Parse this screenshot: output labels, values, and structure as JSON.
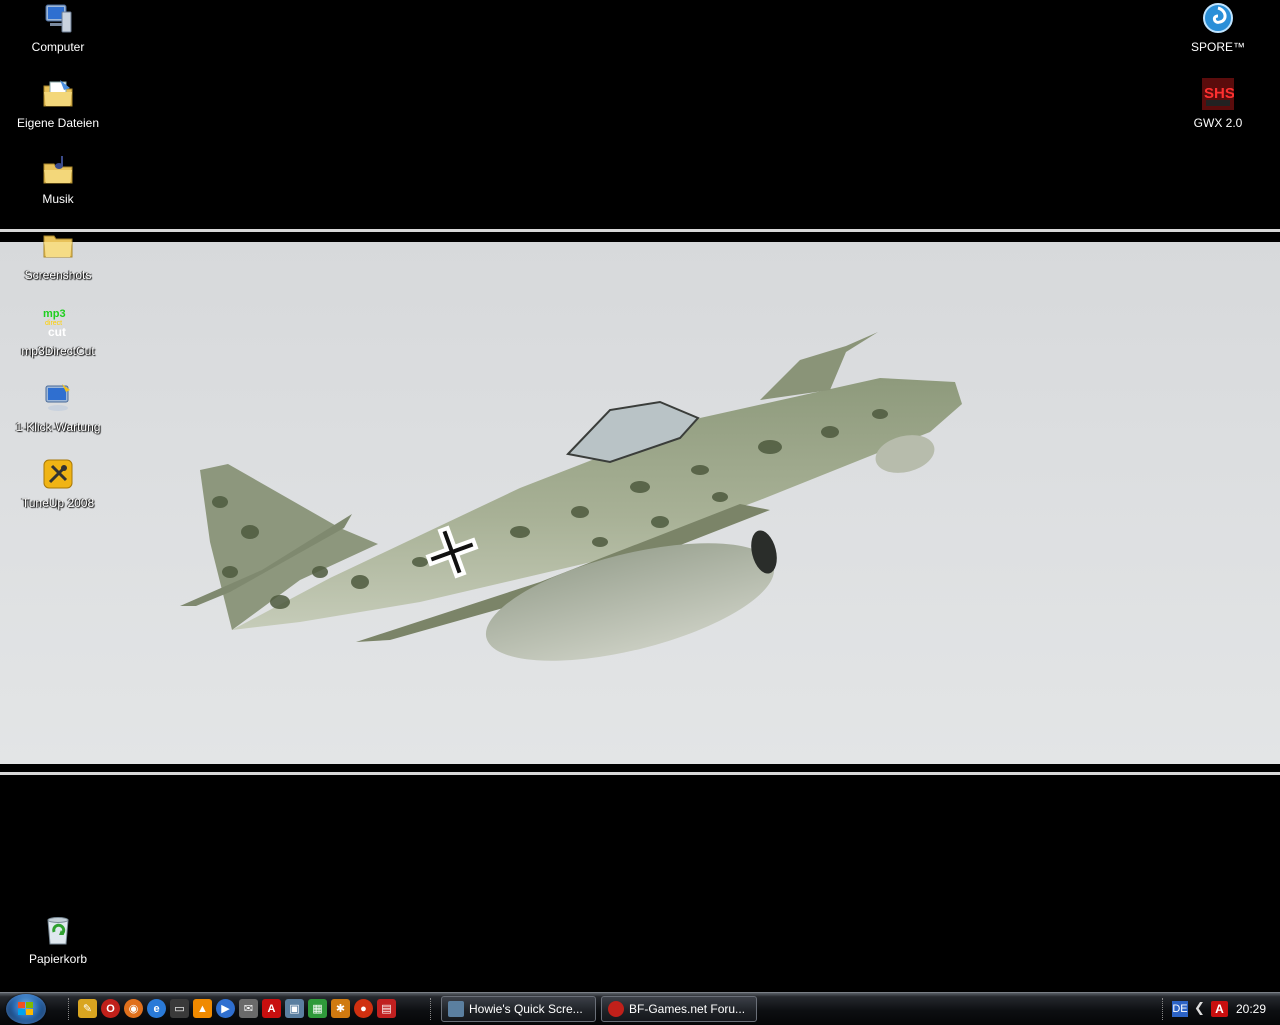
{
  "desktop": {
    "icons_left": [
      {
        "name": "computer",
        "label": "Computer",
        "icon": "computer-icon"
      },
      {
        "name": "eigene-dateien",
        "label": "Eigene Dateien",
        "icon": "documents-folder-icon"
      },
      {
        "name": "musik",
        "label": "Musik",
        "icon": "music-folder-icon"
      },
      {
        "name": "screenshots",
        "label": "Screenshots",
        "icon": "folder-icon"
      },
      {
        "name": "mp3directcut",
        "label": "mp3DirectCut",
        "icon": "mp3directcut-icon"
      },
      {
        "name": "1-klick-wartung",
        "label": "1-Klick-Wartung",
        "icon": "maintenance-icon"
      },
      {
        "name": "tuneup-2008",
        "label": "TuneUp 2008",
        "icon": "tuneup-icon"
      }
    ],
    "icons_right": [
      {
        "name": "spore",
        "label": "SPORE™",
        "icon": "spore-icon"
      },
      {
        "name": "gwx",
        "label": "GWX 2.0",
        "icon": "gwx-icon"
      }
    ],
    "recycle_bin": {
      "label": "Papierkorb",
      "icon": "recycle-bin-icon"
    },
    "wallpaper": {
      "subject": "aircraft-photo",
      "sky_color": "#dcdee0"
    }
  },
  "taskbar": {
    "start_icon": "windows-start-icon",
    "quick_launch": [
      {
        "icon": "pencil-icon",
        "color": "#d9a520"
      },
      {
        "icon": "opera-icon",
        "color": "#c0201a"
      },
      {
        "icon": "firefox-icon",
        "color": "#e0701c"
      },
      {
        "icon": "internet-explorer-icon",
        "color": "#2a7ad8"
      },
      {
        "icon": "terminal-icon",
        "color": "#3a3a3a"
      },
      {
        "icon": "vlc-icon",
        "color": "#f08a00"
      },
      {
        "icon": "media-player-icon",
        "color": "#2f6fd0"
      },
      {
        "icon": "mail-icon",
        "color": "#6a6a6a"
      },
      {
        "icon": "avira-icon",
        "color": "#c80f0f"
      },
      {
        "icon": "screenshot-tool-icon",
        "color": "#5b7fa0"
      },
      {
        "icon": "network-icon",
        "color": "#2f9a3a"
      },
      {
        "icon": "settings-icon",
        "color": "#d07a10"
      },
      {
        "icon": "record-icon",
        "color": "#d03010"
      },
      {
        "icon": "gift-icon",
        "color": "#c02020"
      }
    ],
    "tasks": [
      {
        "label": "Howie's Quick Scre...",
        "icon": "screenshot-tool-icon",
        "color": "#5b7fa0"
      },
      {
        "label": "BF-Games.net Foru...",
        "icon": "opera-icon",
        "color": "#c0201a"
      }
    ],
    "tray": {
      "language": "DE",
      "expand_icon": "chevron-left-icon",
      "antivirus_icon": "avira-icon",
      "clock": "20:29"
    }
  }
}
